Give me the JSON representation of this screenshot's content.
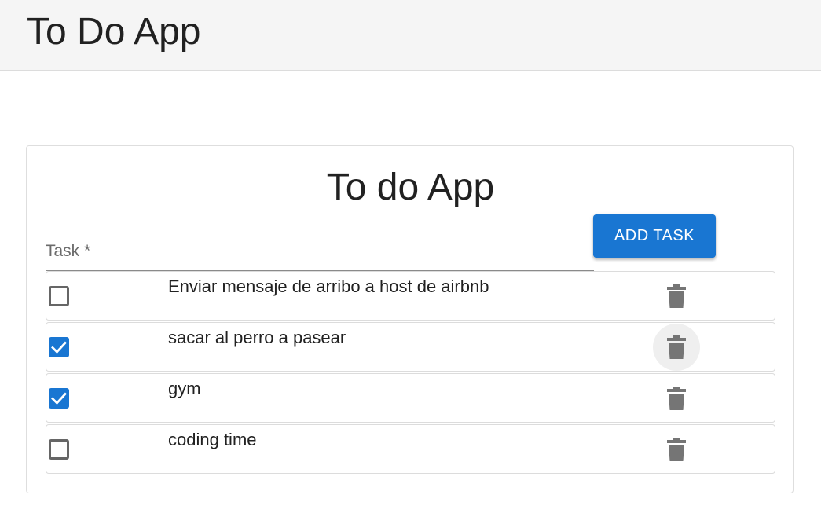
{
  "app": {
    "title": "To Do App"
  },
  "card": {
    "title": "To do App"
  },
  "form": {
    "task_label": "Task *",
    "task_value": "",
    "add_button_label": "ADD TASK"
  },
  "tasks": [
    {
      "text": "Enviar mensaje de arribo a host de airbnb",
      "completed": false
    },
    {
      "text": "sacar al perro a pasear",
      "completed": true
    },
    {
      "text": "gym",
      "completed": true
    },
    {
      "text": "coding time",
      "completed": false
    }
  ],
  "icons": {
    "checkbox_checked": "check-icon",
    "delete": "trash-icon"
  },
  "colors": {
    "primary": "#1976d2",
    "appbar": "#f5f5f5",
    "icon": "#757575"
  }
}
